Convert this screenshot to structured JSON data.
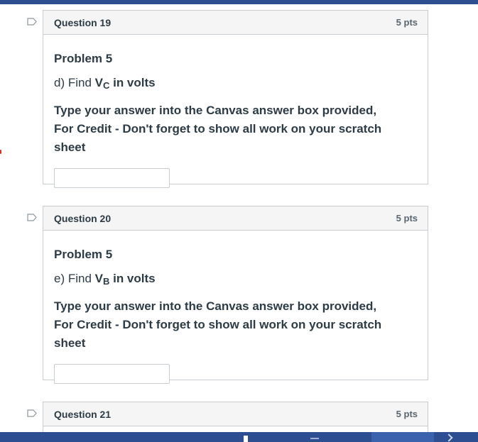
{
  "questions": [
    {
      "title": "Question 19",
      "points": "5 pts",
      "problem": "Problem 5",
      "find_prefix": "d) Find ",
      "var_main": "V",
      "var_sub": "C",
      "find_suffix": " in volts",
      "instructions": "Type your answer into the Canvas answer box provided, For Credit - Don't forget to show all work on your scratch sheet",
      "answer_value": ""
    },
    {
      "title": "Question 20",
      "points": "5 pts",
      "problem": "Problem 5",
      "find_prefix": "e) Find ",
      "var_main": "V",
      "var_sub": "B",
      "find_suffix": " in volts",
      "instructions": "Type your answer into the Canvas answer box provided, For Credit - Don't forget to show all work on your scratch sheet",
      "answer_value": ""
    },
    {
      "title": "Question 21",
      "points": "5 pts"
    }
  ],
  "icons": {
    "flag": "bookmark-flag-icon"
  },
  "colors": {
    "top_bar": "#2d4f91",
    "header_bg": "#f5f5f5",
    "border": "#c7cdd1",
    "text": "#2d3b45"
  }
}
